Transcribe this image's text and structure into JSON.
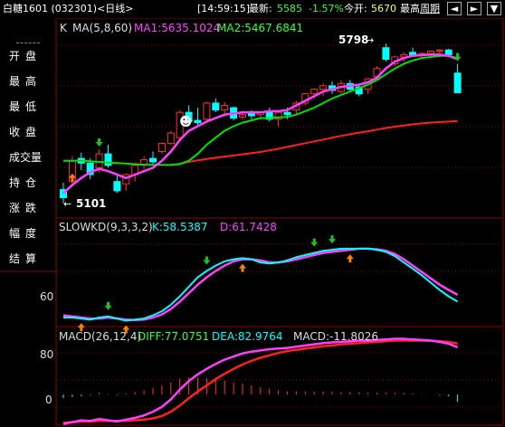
{
  "header": {
    "title": "白糖1601 (032301)<日线>",
    "time": "[14:59:15]",
    "latest_label": "最新:",
    "latest_value": "5585",
    "change_pct": "-1.57%",
    "open_label": "今开:",
    "open_value": "5670",
    "high_label": "最高",
    "period_button": "周期",
    "btn_left": "◄",
    "btn_right": "►",
    "btn_menu": "▼"
  },
  "sidebar": {
    "items": [
      "开盘",
      "最高",
      "最低",
      "收盘",
      "成交量",
      "持仓",
      "涨跌",
      "幅度",
      "结算"
    ]
  },
  "colors": {
    "up": "#ff3030",
    "down": "#00ffff",
    "ma1": "#ff40ff",
    "ma2": "#00e000",
    "ma3": "#ff2020",
    "k_line": "#00ffff",
    "d_line": "#ff40ff",
    "diff": "#ff40ff",
    "dea": "#ff2020",
    "grid": "#8b0000",
    "arrow_buy": "#ff8000",
    "arrow_sell": "#20c020"
  },
  "chart_data": [
    {
      "type": "candlestick",
      "indicator_label": "K",
      "ma_label": "MA(5,8,60)",
      "ma1_label": "MA1:5635.1024",
      "ma2_label": "MA2:5467.6841",
      "max_marker": "5798",
      "min_marker": "5101",
      "smiley_icon": "☻",
      "ylim": [
        5085,
        5830
      ],
      "candles": [
        [
          5165,
          5195,
          5105,
          5130
        ],
        [
          5200,
          5310,
          5180,
          5290
        ],
        [
          5300,
          5325,
          5250,
          5280
        ],
        [
          5280,
          5300,
          5210,
          5230
        ],
        [
          5260,
          5340,
          5240,
          5320
        ],
        [
          5320,
          5360,
          5260,
          5270
        ],
        [
          5200,
          5235,
          5150,
          5160
        ],
        [
          5190,
          5235,
          5160,
          5230
        ],
        [
          5230,
          5280,
          5200,
          5270
        ],
        [
          5275,
          5310,
          5255,
          5295
        ],
        [
          5300,
          5330,
          5270,
          5285
        ],
        [
          5330,
          5370,
          5320,
          5365
        ],
        [
          5365,
          5420,
          5360,
          5410
        ],
        [
          5390,
          5510,
          5380,
          5500
        ],
        [
          5500,
          5530,
          5440,
          5460
        ],
        [
          5465,
          5520,
          5440,
          5455
        ],
        [
          5470,
          5545,
          5460,
          5540
        ],
        [
          5540,
          5560,
          5500,
          5510
        ],
        [
          5510,
          5545,
          5480,
          5530
        ],
        [
          5520,
          5525,
          5465,
          5475
        ],
        [
          5480,
          5505,
          5470,
          5490
        ],
        [
          5495,
          5510,
          5470,
          5485
        ],
        [
          5490,
          5505,
          5470,
          5500
        ],
        [
          5500,
          5520,
          5460,
          5470
        ],
        [
          5470,
          5510,
          5440,
          5500
        ],
        [
          5500,
          5520,
          5470,
          5490
        ],
        [
          5510,
          5550,
          5490,
          5540
        ],
        [
          5540,
          5585,
          5530,
          5580
        ],
        [
          5580,
          5605,
          5560,
          5600
        ],
        [
          5600,
          5625,
          5570,
          5615
        ],
        [
          5615,
          5635,
          5580,
          5595
        ],
        [
          5590,
          5640,
          5580,
          5625
        ],
        [
          5625,
          5640,
          5590,
          5600
        ],
        [
          5610,
          5620,
          5570,
          5580
        ],
        [
          5600,
          5650,
          5580,
          5645
        ],
        [
          5655,
          5700,
          5640,
          5690
        ],
        [
          5780,
          5798,
          5720,
          5730
        ],
        [
          5710,
          5745,
          5700,
          5740
        ],
        [
          5740,
          5760,
          5720,
          5750
        ],
        [
          5760,
          5780,
          5740,
          5745
        ],
        [
          5745,
          5760,
          5735,
          5755
        ],
        [
          5755,
          5770,
          5745,
          5765
        ],
        [
          5765,
          5775,
          5755,
          5770
        ],
        [
          5770,
          5775,
          5740,
          5750
        ],
        [
          5670,
          5710,
          5590,
          5585
        ]
      ],
      "ma1": [
        5150,
        5185,
        5215,
        5240,
        5255,
        5245,
        5230,
        5215,
        5230,
        5245,
        5260,
        5290,
        5330,
        5380,
        5420,
        5440,
        5460,
        5475,
        5490,
        5495,
        5500,
        5500,
        5500,
        5505,
        5505,
        5510,
        5530,
        5550,
        5570,
        5590,
        5600,
        5610,
        5615,
        5620,
        5630,
        5650,
        5690,
        5720,
        5735,
        5745,
        5748,
        5750,
        5750,
        5745,
        5730
      ],
      "ma2": [
        5290,
        5290,
        5290,
        5288,
        5285,
        5282,
        5280,
        5278,
        5275,
        5273,
        5272,
        5272,
        5272,
        5275,
        5290,
        5320,
        5360,
        5390,
        5420,
        5440,
        5455,
        5465,
        5475,
        5475,
        5478,
        5480,
        5490,
        5505,
        5520,
        5540,
        5560,
        5575,
        5590,
        5605,
        5620,
        5640,
        5665,
        5690,
        5710,
        5725,
        5735,
        5740,
        5745,
        5745,
        5735
      ],
      "ma3": [
        null,
        null,
        null,
        null,
        null,
        null,
        null,
        null,
        null,
        null,
        null,
        null,
        5270,
        5278,
        5285,
        5292,
        5298,
        5303,
        5308,
        5313,
        5318,
        5323,
        5328,
        5335,
        5342,
        5350,
        5358,
        5366,
        5374,
        5382,
        5390,
        5398,
        5405,
        5412,
        5418,
        5425,
        5432,
        5438,
        5443,
        5448,
        5452,
        5455,
        5458,
        5460,
        5462
      ],
      "buy_arrows": [
        1
      ],
      "sell_arrows": [
        4
      ],
      "sell_arrow_last": [
        44
      ]
    },
    {
      "type": "line",
      "indicator_label": "SLOWKD(9,3,3,2)",
      "k_label": "K:58.5387",
      "d_label": "D:61.7428",
      "tick_label": "60",
      "ylim": [
        48,
        92
      ],
      "k": [
        51.0,
        51.0,
        50.5,
        50.0,
        51.0,
        51.5,
        50.5,
        49.5,
        50.0,
        50.5,
        52.0,
        54.0,
        57.0,
        61.0,
        65.5,
        70.0,
        73.0,
        75.5,
        77.5,
        78.5,
        79.0,
        78.5,
        77.0,
        76.5,
        77.0,
        78.0,
        79.5,
        80.5,
        81.5,
        82.5,
        83.0,
        83.5,
        83.5,
        83.5,
        83.5,
        83.0,
        82.0,
        80.0,
        77.0,
        74.0,
        71.0,
        67.5,
        64.0,
        61.0,
        58.5
      ],
      "d": [
        52.0,
        51.5,
        51.0,
        50.5,
        50.5,
        51.0,
        50.5,
        50.0,
        49.8,
        50.0,
        51.0,
        52.5,
        55.0,
        58.5,
        62.5,
        66.5,
        70.0,
        73.0,
        75.5,
        77.5,
        78.5,
        78.5,
        78.0,
        77.0,
        77.0,
        77.5,
        78.5,
        79.5,
        80.5,
        81.5,
        82.0,
        82.5,
        83.0,
        83.5,
        83.5,
        83.2,
        82.5,
        81.0,
        78.5,
        75.5,
        72.5,
        69.5,
        66.5,
        64.0,
        61.7
      ],
      "buy_arrows": [
        2,
        7,
        20,
        32
      ],
      "sell_arrows": [
        5,
        16,
        28,
        30
      ]
    },
    {
      "type": "bar",
      "indicator_label": "MACD(26,12,4)",
      "diff_label": "DIFF:77.0751",
      "dea_label": "DEA:82.9764",
      "macd_label": "MACD:-11.8026",
      "tick_labels": [
        "80",
        "0"
      ],
      "ylim": [
        -50,
        105
      ],
      "diff": [
        -48,
        -45,
        -42,
        -43,
        -40,
        -42,
        -44,
        -41,
        -38,
        -34,
        -28,
        -20,
        -8,
        8,
        22,
        33,
        42,
        50,
        57,
        62,
        67,
        70,
        72,
        74,
        75,
        76,
        78,
        80,
        82,
        84,
        85,
        86,
        87,
        88,
        88,
        89,
        90,
        91,
        91,
        90,
        89,
        88,
        86,
        83,
        77
      ],
      "dea": [
        -46,
        -45,
        -44,
        -44,
        -43,
        -43,
        -43,
        -43,
        -42,
        -41,
        -39,
        -35,
        -28,
        -18,
        -6,
        5,
        15,
        25,
        34,
        42,
        49,
        55,
        60,
        64,
        68,
        71,
        73,
        75,
        77,
        79,
        80,
        82,
        83,
        84,
        85,
        86,
        87,
        88,
        88,
        88,
        88,
        88,
        87,
        86,
        83
      ],
      "macd_hist": [
        -6,
        -4,
        -3,
        -1,
        3,
        1,
        -1,
        2,
        4,
        7,
        11,
        15,
        20,
        26,
        28,
        28,
        27,
        25,
        23,
        20,
        18,
        15,
        12,
        10,
        7,
        5,
        5,
        5,
        5,
        5,
        5,
        4,
        4,
        4,
        3,
        3,
        3,
        3,
        3,
        2,
        1,
        0,
        -1,
        -3,
        -12
      ]
    }
  ]
}
